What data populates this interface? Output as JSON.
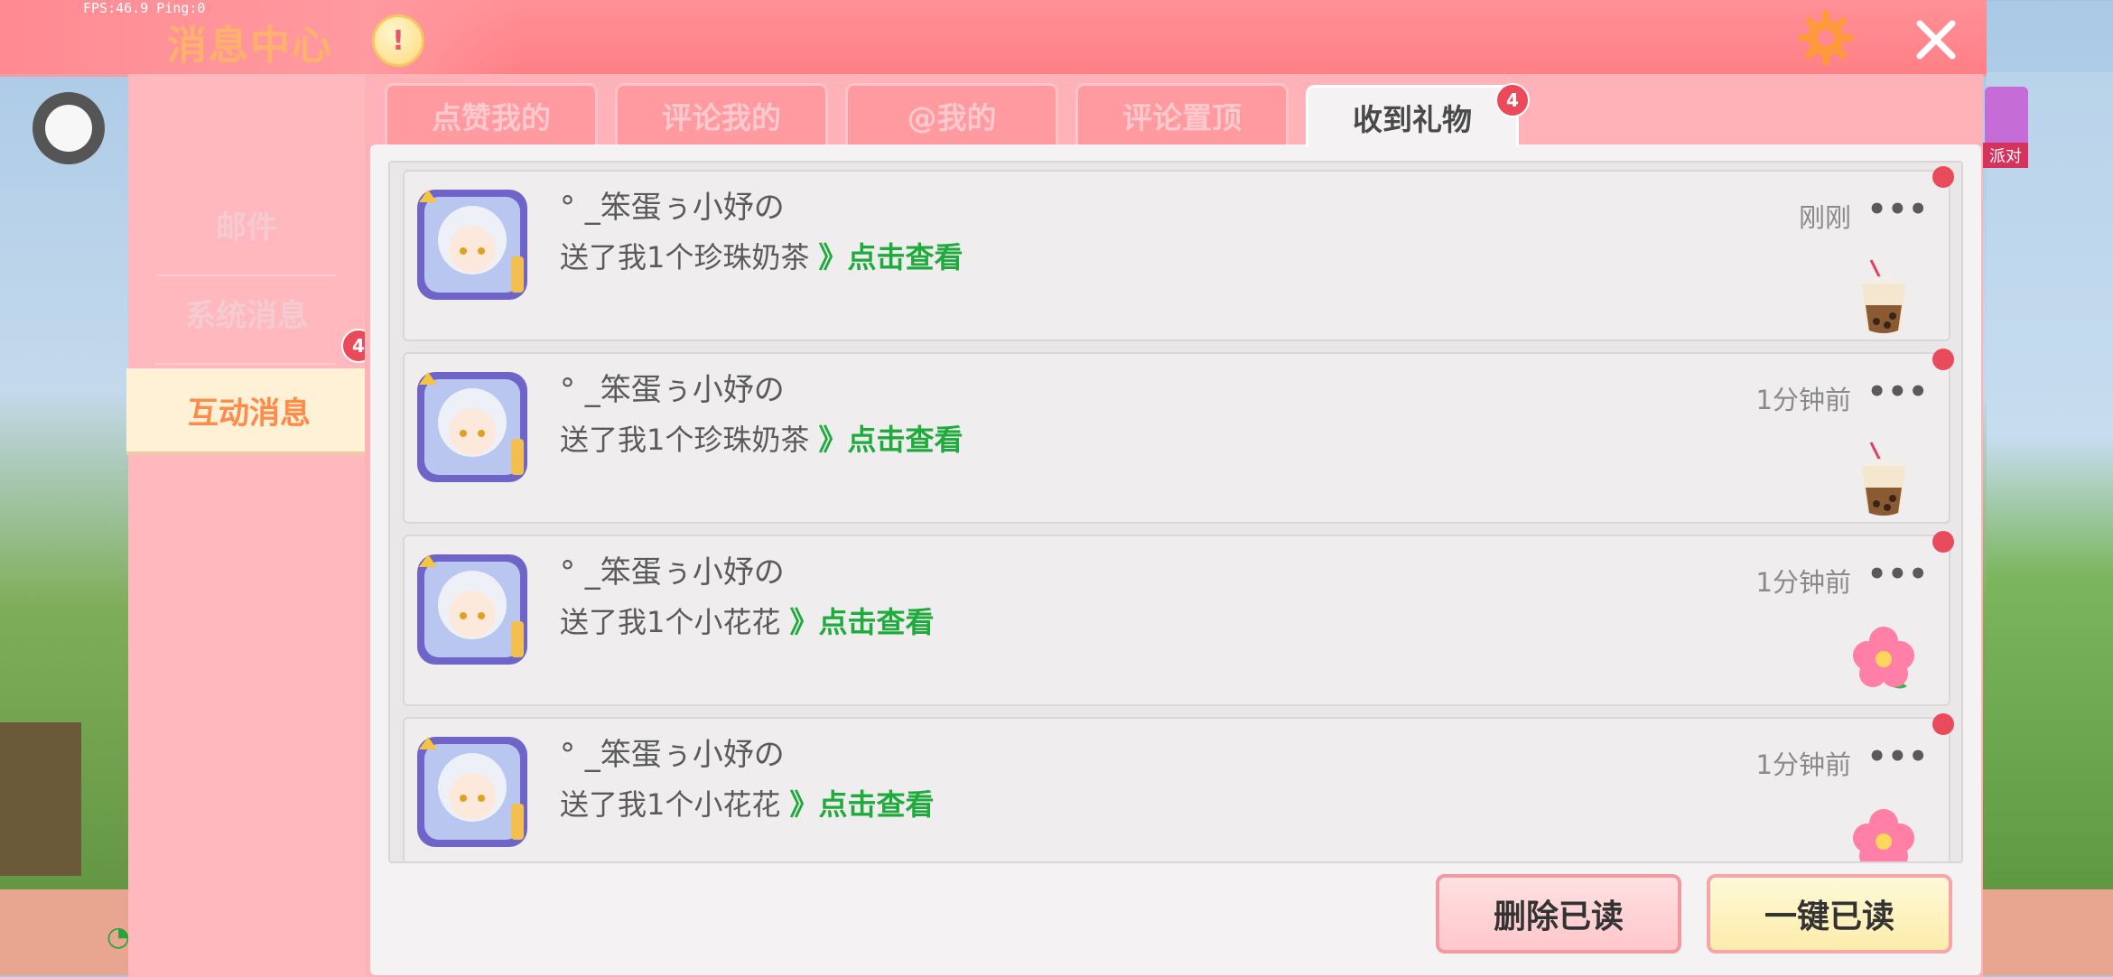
{
  "status": {
    "fps_text": "FPS:46.9 Ping:0"
  },
  "header": {
    "title": "消息中心",
    "notice_icon": "exclamation-icon",
    "settings_icon": "gear-icon",
    "close_icon": "close-icon"
  },
  "sidebar": {
    "items": [
      {
        "label": "邮件",
        "active": false
      },
      {
        "label": "系统消息",
        "active": false
      },
      {
        "label": "互动消息",
        "active": true,
        "badge": "4"
      }
    ]
  },
  "tabs": [
    {
      "label": "点赞我的",
      "active": false
    },
    {
      "label": "评论我的",
      "active": false
    },
    {
      "label": "@我的",
      "active": false
    },
    {
      "label": "评论置顶",
      "active": false
    },
    {
      "label": "收到礼物",
      "active": true,
      "badge": "4"
    }
  ],
  "messages": [
    {
      "name": "° _笨蛋ぅ小妤の",
      "text": "送了我1个珍珠奶茶",
      "link": "》点击查看",
      "time": "刚刚",
      "gift": "milk-tea-icon",
      "unread": true
    },
    {
      "name": "° _笨蛋ぅ小妤の",
      "text": "送了我1个珍珠奶茶",
      "link": "》点击查看",
      "time": "1分钟前",
      "gift": "milk-tea-icon",
      "unread": true
    },
    {
      "name": "° _笨蛋ぅ小妤の",
      "text": "送了我1个小花花",
      "link": "》点击查看",
      "time": "1分钟前",
      "gift": "flower-icon",
      "unread": true
    },
    {
      "name": "° _笨蛋ぅ小妤の",
      "text": "送了我1个小花花",
      "link": "》点击查看",
      "time": "1分钟前",
      "gift": "flower-icon",
      "unread": true
    }
  ],
  "more_label": "•••",
  "buttons": {
    "delete_read": "删除已读",
    "mark_all_read": "一键已读"
  },
  "side_ad": {
    "label": "派对"
  },
  "colors": {
    "header": "#ff8890",
    "link_green": "#1faa3c",
    "badge_red": "#e84c5c",
    "active_tab_text": "#4a4a4a"
  }
}
